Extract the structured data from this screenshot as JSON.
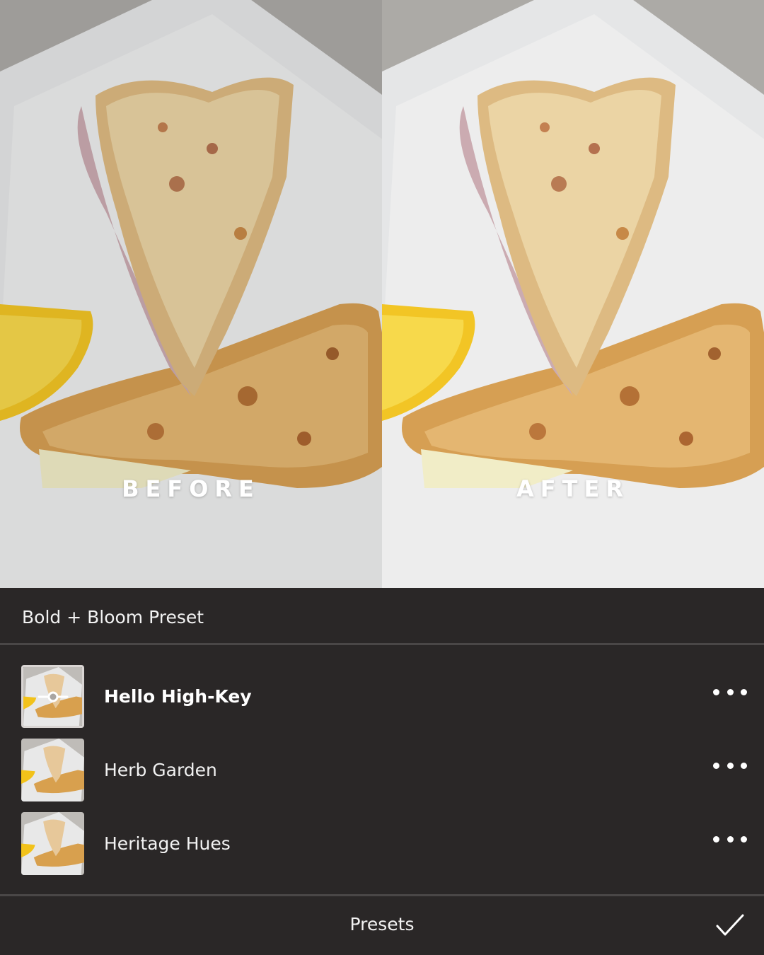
{
  "comparison": {
    "before_label": "BEFORE",
    "after_label": "AFTER"
  },
  "preset_group": {
    "title": "Bold + Bloom Preset"
  },
  "presets": [
    {
      "name": "Hello High-Key",
      "selected": true,
      "thumbnail_icon": "slider-adjust-icon"
    },
    {
      "name": "Herb Garden",
      "selected": false
    },
    {
      "name": "Heritage Hues",
      "selected": false
    }
  ],
  "footer": {
    "title": "Presets",
    "confirm_icon": "checkmark-icon"
  },
  "colors": {
    "panel_background": "#2a2727",
    "divider": "#4a4747",
    "text": "#f2f2f2",
    "selected_thumb_border": "#d9d5d3"
  }
}
